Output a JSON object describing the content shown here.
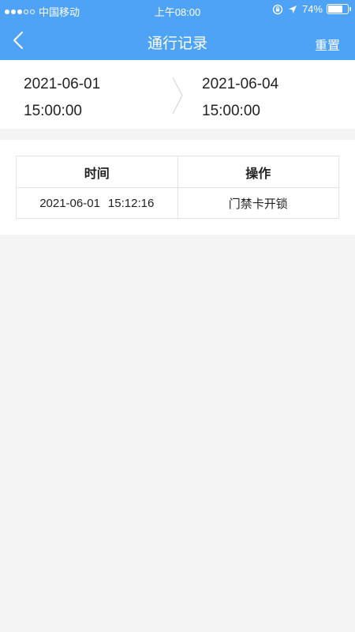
{
  "status_bar": {
    "carrier": "中国移动",
    "time": "上午08:00",
    "battery_percent": "74%",
    "battery_level": 74,
    "signal_bars_filled": 3,
    "signal_bars_total": 5
  },
  "nav": {
    "title": "通行记录",
    "reset_label": "重置"
  },
  "date_range": {
    "start_date": "2021-06-01",
    "start_time": "15:00:00",
    "end_date": "2021-06-04",
    "end_time": "15:00:00"
  },
  "table": {
    "headers": [
      "时间",
      "操作"
    ],
    "rows": [
      {
        "date": "2021-06-01",
        "time": "15:12:16",
        "action": "门禁卡开锁"
      }
    ]
  },
  "colors": {
    "accent": "#4fa3f7",
    "background": "#f4f4f4"
  }
}
